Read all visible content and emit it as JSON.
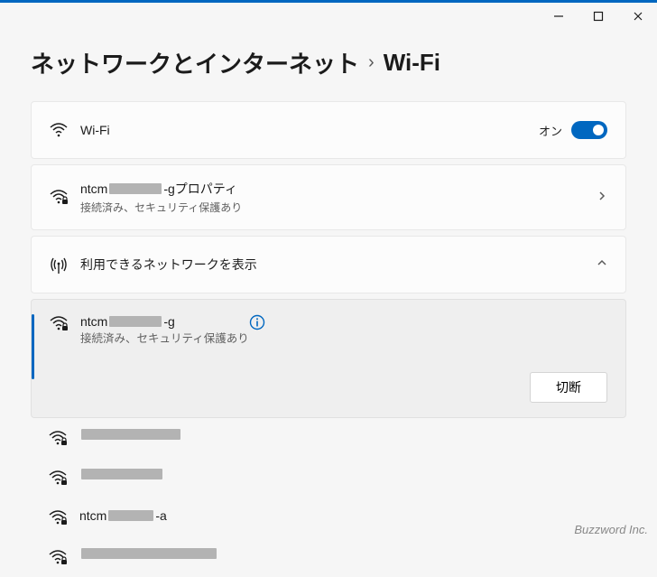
{
  "window": {
    "min_tooltip": "最小化",
    "max_tooltip": "最大化",
    "close_tooltip": "閉じる"
  },
  "breadcrumb": {
    "parent": "ネットワークとインターネット",
    "current": "Wi-Fi"
  },
  "colors": {
    "accent": "#0067c0"
  },
  "wifi_tile": {
    "title": "Wi-Fi",
    "state_label": "オン",
    "state_on": true
  },
  "connected_tile": {
    "name_prefix": "ntcm",
    "name_suffix": "-g",
    "name_suffix_extra": " プロパティ",
    "sub": "接続済み、セキュリティ保護あり"
  },
  "available_tile": {
    "title": "利用できるネットワークを表示",
    "expanded": true
  },
  "networks": {
    "selected": {
      "name_prefix": "ntcm",
      "name_suffix": "-g",
      "sub": "接続済み、セキュリティ保護あり",
      "disconnect_label": "切断"
    },
    "others": [
      {
        "name_prefix": "",
        "name_suffix": "",
        "redact_w": 110
      },
      {
        "name_prefix": "",
        "name_suffix": "",
        "redact_w": 90
      },
      {
        "name_prefix": "ntcm",
        "name_suffix": "-a",
        "redact_w": 50
      },
      {
        "name_prefix": "",
        "name_suffix": "",
        "redact_w": 150
      }
    ]
  },
  "watermark": "Buzzword Inc."
}
